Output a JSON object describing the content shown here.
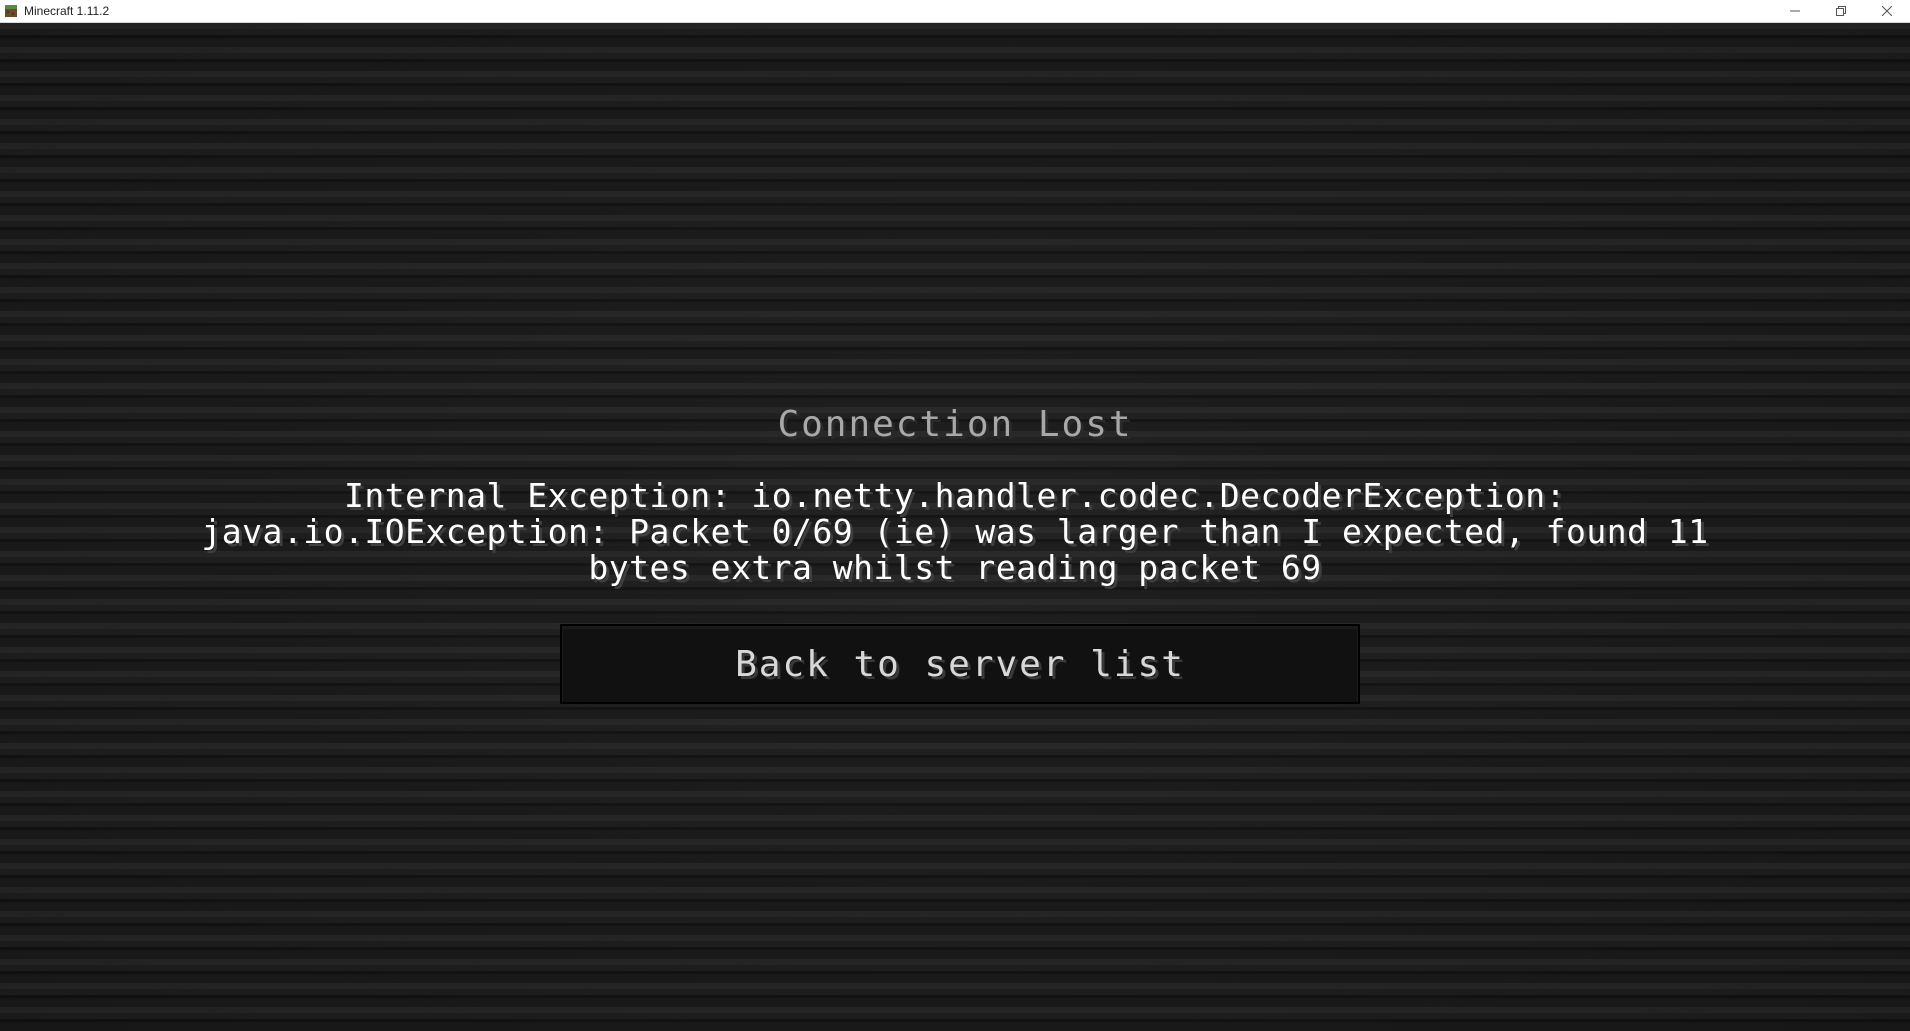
{
  "window": {
    "title": "Minecraft 1.11.2",
    "app_icon": "minecraft-grass-block-icon",
    "controls": {
      "minimize_icon": "minimize-icon",
      "restore_icon": "restore-icon",
      "close_icon": "close-icon"
    }
  },
  "disconnect_screen": {
    "heading": "Connection Lost",
    "message": "Internal Exception: io.netty.handler.codec.DecoderException: java.io.IOException: Packet 0/69 (ie) was larger than I expected, found 11 bytes extra whilst reading packet 69",
    "back_button_label": "Back to server list"
  },
  "colors": {
    "heading": "#a8a8a8",
    "message": "#ffffff",
    "button_text": "#d8d8d8",
    "button_bg": "#111111",
    "background": "#1c1c1c"
  }
}
